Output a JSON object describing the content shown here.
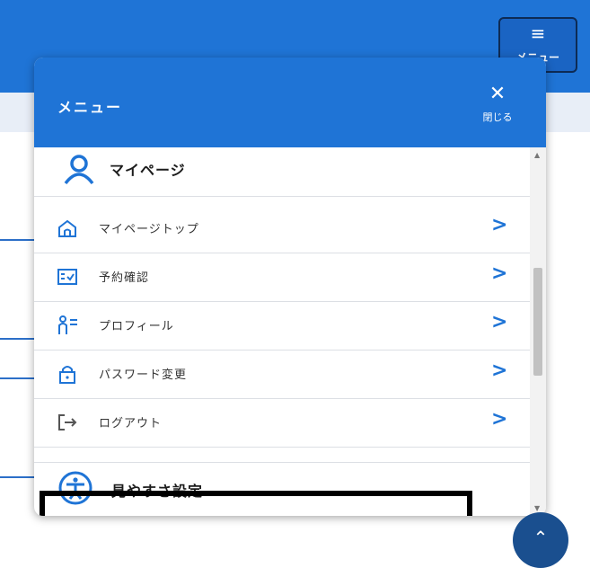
{
  "header": {
    "menu_button_label": "メニュー"
  },
  "panel": {
    "title": "メニュー",
    "close_label": "閉じる",
    "section_title": "マイページ",
    "items": [
      {
        "label": "マイページトップ",
        "icon": "home-icon"
      },
      {
        "label": "予約確認",
        "icon": "reservation-check-icon"
      },
      {
        "label": "プロフィール",
        "icon": "profile-icon"
      },
      {
        "label": "パスワード変更",
        "icon": "lock-icon"
      },
      {
        "label": "ログアウト",
        "icon": "logout-icon"
      }
    ],
    "accessibility_title": "見やすさ設定"
  },
  "colors": {
    "primary": "#1f74d6",
    "dark": "#1a4f8f",
    "highlight_border": "#000000"
  }
}
